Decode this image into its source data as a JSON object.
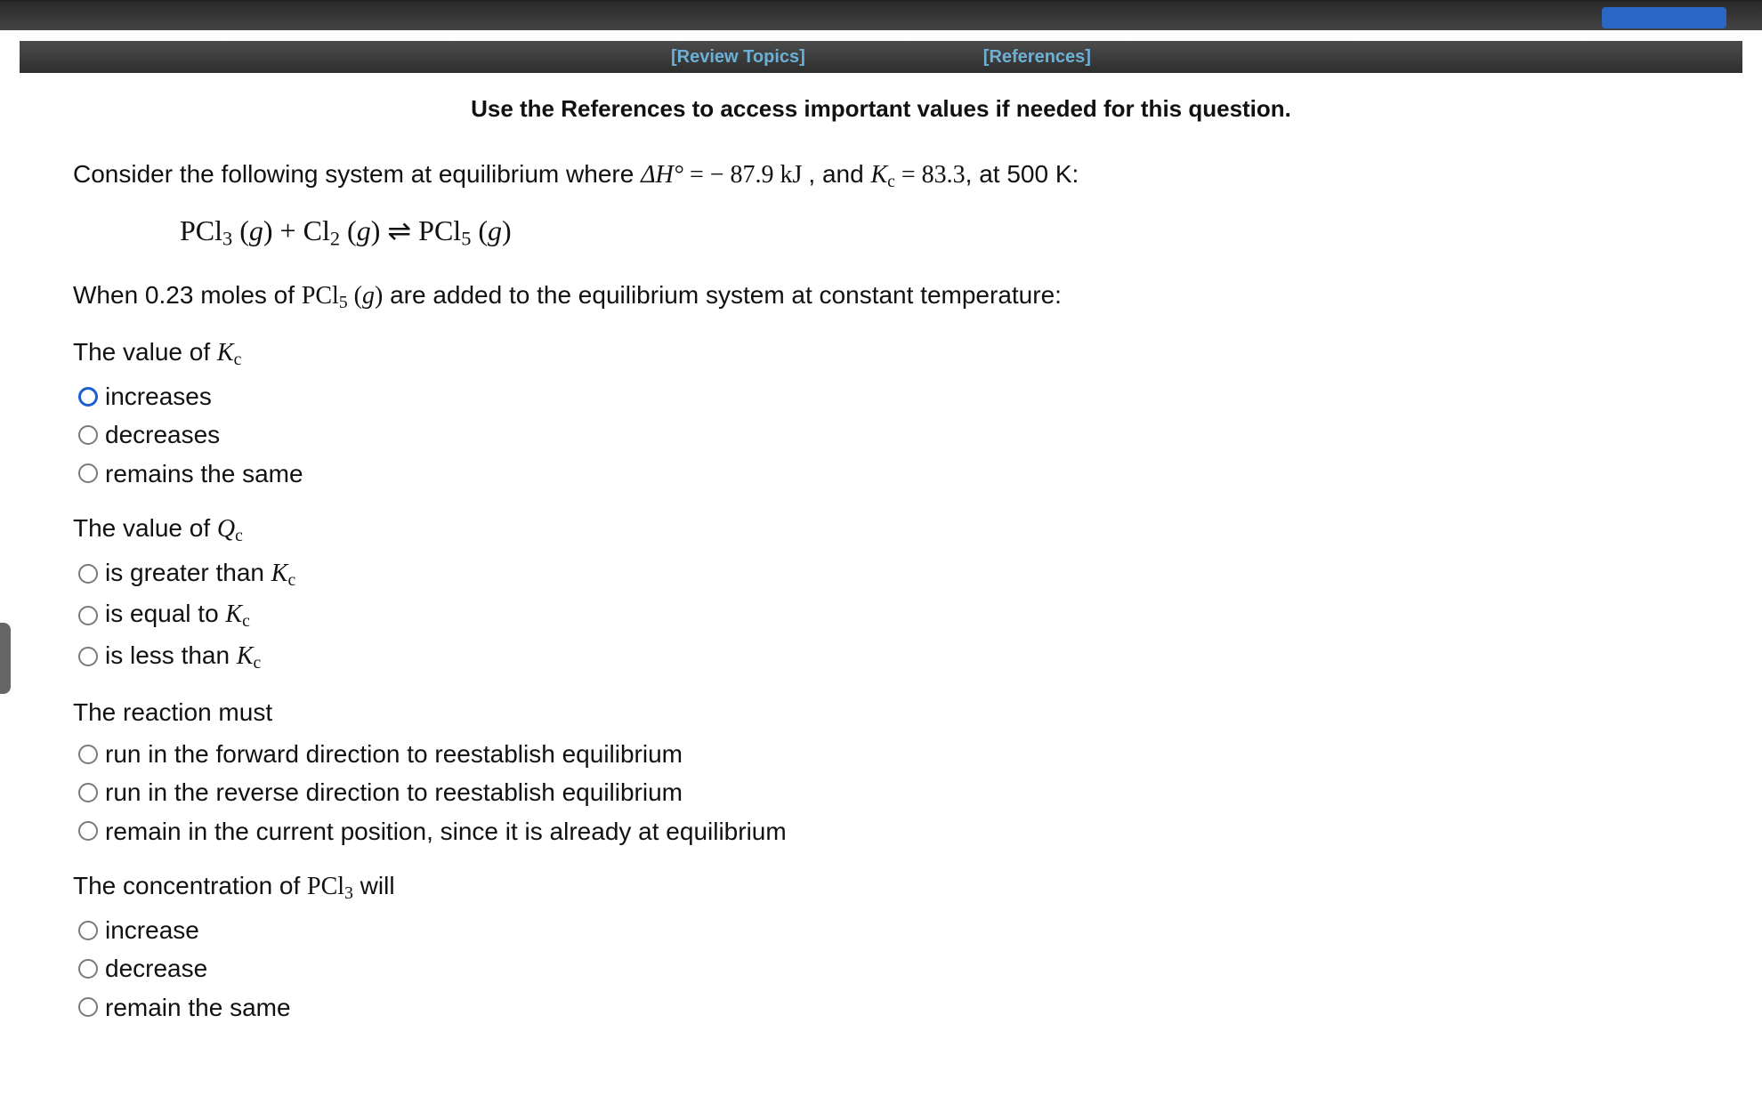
{
  "toolbar": {
    "review": "[Review Topics]",
    "references": "[References]"
  },
  "instruction": "Use the References to access important values if needed for this question.",
  "intro": {
    "prefix": "Consider the following system at equilibrium where ",
    "dh_sym": "ΔH°",
    "eq1": " = − 87.9  kJ",
    "mid": ", and ",
    "kc_sym_html": "K<sub>c</sub>",
    "eq2": " = 83.3",
    "suffix": ", at 500 K:"
  },
  "reaction_html": "PCl<sub>3</sub> (<span class='italic'>g</span>) + Cl<sub>2</sub> (<span class='italic'>g</span>) ⇌ PCl<sub>5</sub> (<span class='italic'>g</span>)",
  "added": {
    "prefix": "When 0.23 moles of ",
    "species_html": "PCl<sub>5</sub> (<span class='italic'>g</span>)",
    "suffix": " are added to the equilibrium system at constant temperature:"
  },
  "q1": {
    "prompt_prefix": "The value of ",
    "prompt_sym_html": "K<sub>c</sub>",
    "options": [
      "increases",
      "decreases",
      "remains the same"
    ],
    "selected": 0
  },
  "q2": {
    "prompt_prefix": "The value of ",
    "prompt_sym_html": "Q<sub>c</sub>",
    "options_html": [
      "is greater than <span class='math italic'>K</span><sub class='math'>c</sub>",
      "is equal to <span class='math italic'>K</span><sub class='math'>c</sub>",
      "is less than <span class='math italic'>K</span><sub class='math'>c</sub>"
    ]
  },
  "q3": {
    "prompt": "The reaction must",
    "options": [
      "run in the forward direction to reestablish equilibrium",
      "run in the reverse direction to reestablish equilibrium",
      "remain in the current position, since it is already at equilibrium"
    ]
  },
  "q4": {
    "prompt_prefix": "The concentration of ",
    "prompt_sym_html": "PCl<sub>3</sub>",
    "prompt_suffix": " will",
    "options": [
      "increase",
      "decrease",
      "remain the same"
    ]
  }
}
